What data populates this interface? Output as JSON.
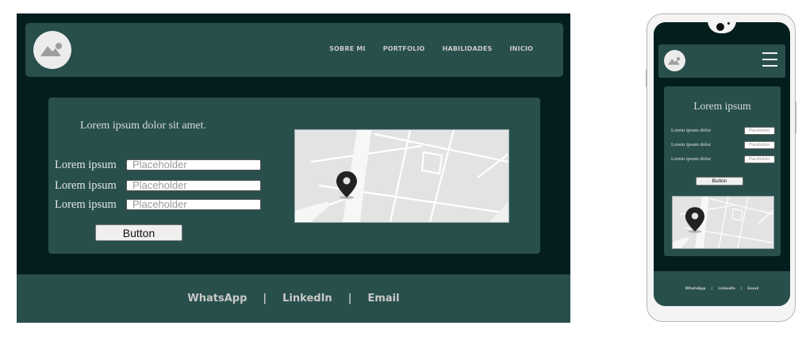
{
  "desktop": {
    "nav": [
      "SOBRE MI",
      "PORTFOLIO",
      "HABILIDADES",
      "INICIO"
    ],
    "card_title": "Lorem ipsum dolor sit amet.",
    "form": [
      {
        "label": "Lorem ipsum",
        "placeholder": "Placeholder"
      },
      {
        "label": "Lorem ipsum",
        "placeholder": "Placeholder"
      },
      {
        "label": "Lorem ipsum",
        "placeholder": "Placeholder"
      }
    ],
    "button_label": "Button",
    "footer": {
      "links": [
        "WhatsApp",
        "LinkedIn",
        "Email"
      ],
      "separator": "|"
    }
  },
  "mobile": {
    "card_title": "Lorem ipsum",
    "form": [
      {
        "label": "Lorem ipsum dolor",
        "placeholder": "Placeholder"
      },
      {
        "label": "Lorem ipsum dolor",
        "placeholder": "Placeholder"
      },
      {
        "label": "Lorem ipsum dolor",
        "placeholder": "Placeholder"
      }
    ],
    "button_label": "Button",
    "footer": {
      "links": [
        "WhatsApp",
        "LinkedIn",
        "Email"
      ],
      "separator": "|"
    }
  },
  "icons": {
    "avatar": "image-placeholder-icon",
    "map_pin": "map-pin-icon",
    "menu": "hamburger-menu-icon"
  },
  "colors": {
    "page_bg": "#041e1e",
    "panel": "#284f4c",
    "nav_text": "#c9c9c9"
  }
}
